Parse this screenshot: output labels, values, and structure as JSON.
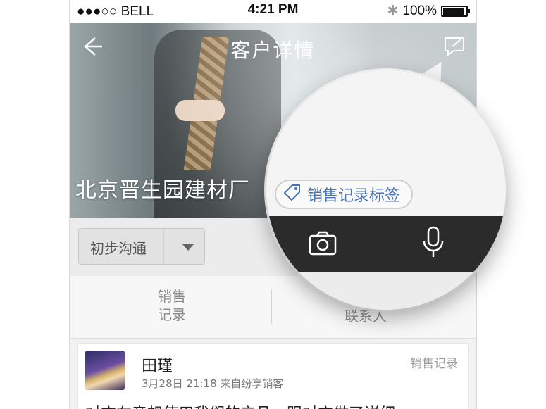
{
  "status_bar": {
    "signal": "●●●○○",
    "carrier": "BELL",
    "time": "4:21 PM",
    "battery": "100%",
    "battery_level": 1.0
  },
  "nav": {
    "title": "客户详情",
    "back_icon": "arrow-left-icon",
    "edit_icon": "edit-note-icon"
  },
  "company": {
    "name": "北京晋生园建材厂"
  },
  "stage": {
    "selected": "初步沟通"
  },
  "tabs": [
    {
      "label_line1": "销售",
      "label_line2": "记录"
    },
    {
      "label_line1": "联系人"
    }
  ],
  "record": {
    "name": "田瑾",
    "meta": "3月28日 21:18  来自纷享销客",
    "type": "销售记录",
    "content": "对方有意想使用我们的产品，跟对方做了详细"
  },
  "zoom": {
    "tag_label": "销售记录标签",
    "tag_icon": "tag-icon",
    "camera_icon": "camera-icon",
    "mic_icon": "microphone-icon"
  },
  "colors": {
    "accent": "#4a73b5",
    "toolbar": "#2b2b2b"
  }
}
